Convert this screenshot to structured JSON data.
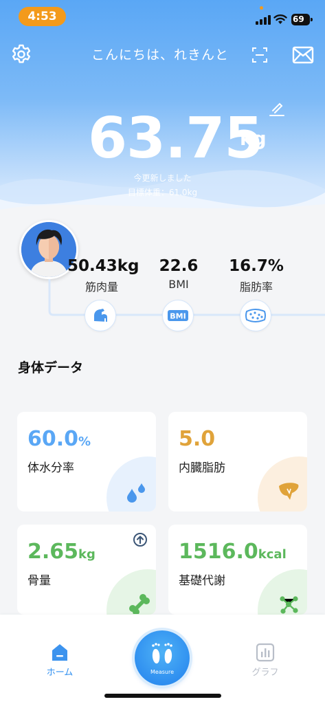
{
  "status_bar": {
    "time": "4:53",
    "battery": "69"
  },
  "header": {
    "greeting": "こんにちは、れきんと",
    "weight_value": "63.75",
    "weight_unit": "kg",
    "updated_text": "今更新しました",
    "target_text": "目標体重：61.0kg"
  },
  "summary": {
    "metrics": [
      {
        "value": "50.43kg",
        "label": "筋肉量",
        "icon": "muscle-arm-icon"
      },
      {
        "value": "22.6",
        "label": "BMI",
        "icon": "bmi-badge-icon",
        "icon_text": "BMI"
      },
      {
        "value": "16.7%",
        "label": "脂肪率",
        "icon": "fat-cells-icon"
      }
    ]
  },
  "body_data": {
    "title": "身体データ",
    "cards": [
      {
        "value": "60.0",
        "unit": "%",
        "label": "体水分率",
        "color": "#5aa7f5",
        "icon": "water-drops-icon"
      },
      {
        "value": "5.0",
        "unit": "",
        "label": "内臓脂肪",
        "color": "#e0a33a",
        "icon": "liver-icon"
      },
      {
        "value": "2.65",
        "unit": "kg",
        "label": "骨量",
        "color": "#5cb85c",
        "icon": "bone-icon",
        "badge": "arrow-up-circle-icon"
      },
      {
        "value": "1516.0",
        "unit": "kcal",
        "label": "基礎代謝",
        "color": "#5cb85c",
        "icon": "molecule-icon"
      }
    ]
  },
  "tabbar": {
    "home_label": "ホーム",
    "measure_label": "Measure",
    "graph_label": "グラフ"
  },
  "colors": {
    "accent_blue": "#2f8ff0",
    "status_orange": "#f39a1b",
    "water_blue": "#5aa7f5",
    "visceral_orange": "#e0a33a",
    "bone_green": "#5cb85c"
  }
}
